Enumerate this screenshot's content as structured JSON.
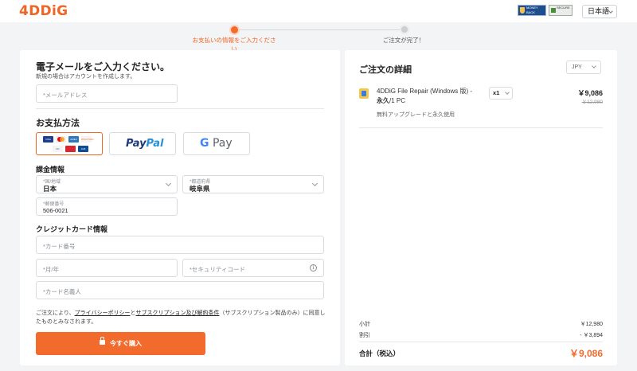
{
  "header": {
    "logo": "4DDiG",
    "badge_guarantee": "MONEY BACK GUARANTEE",
    "badge_secure": "SECURE",
    "language": "日本語"
  },
  "steps": [
    {
      "label": "お支払いの情報をご入力ください",
      "active": true
    },
    {
      "label": "ご注文が完了！",
      "active": false
    }
  ],
  "email_section": {
    "title": "電子メールをご入力ください。",
    "subtitle": "新規の場合はアカウントを作成します。",
    "email_placeholder": "*メールアドレス"
  },
  "payment": {
    "title": "お支払方法",
    "options": [
      {
        "name": "credit-card",
        "cards": [
          "VISA",
          "MC",
          "AMEX",
          "DISCOVER",
          "DC",
          "UnionPay",
          "JCB"
        ],
        "selected": true
      },
      {
        "name": "paypal",
        "label1": "Pay",
        "label2": "Pal",
        "selected": false
      },
      {
        "name": "google-pay",
        "label_g": "G",
        "label_pay": "Pay",
        "selected": false
      }
    ]
  },
  "billing": {
    "title": "課金情報",
    "country": {
      "label": "*国/地域",
      "value": "日本"
    },
    "prefecture": {
      "label": "*都道府県",
      "value": "岐阜県"
    },
    "postal": {
      "label": "*郵便番号",
      "value": "506-0021"
    }
  },
  "card": {
    "title": "クレジットカード情報",
    "number_placeholder": "*カード番号",
    "expiry_placeholder": "*月/年",
    "cvc_placeholder": "*セキュリティコード",
    "name_placeholder": "*カード名義人"
  },
  "terms": {
    "prefix": "ご注文により、",
    "privacy_link": "プライバシーポリシー",
    "and": "と",
    "subscription_link": "サブスクリプション及び解約条件",
    "suffix": "（サブスクリプション製品のみ）に同意したものとみなされます。"
  },
  "buy_button": "今すぐ購入",
  "order": {
    "title": "ご注文の詳細",
    "currency": "JPY",
    "product_name_line1": "4DDiG File Repair (Windows 版) -",
    "product_name_line2_bold": "永久",
    "product_name_line2_rest": "/1 PC",
    "product_note": "無料アップグレードと永久使用",
    "quantity": "x1",
    "price": "￥9,086",
    "original_price": "￥12,980",
    "subtotal_label": "小計",
    "subtotal_value": "￥12,980",
    "discount_label": "割引",
    "discount_value": "- ￥3,894",
    "total_label": "合計（税込）",
    "total_value": "￥9,086"
  }
}
